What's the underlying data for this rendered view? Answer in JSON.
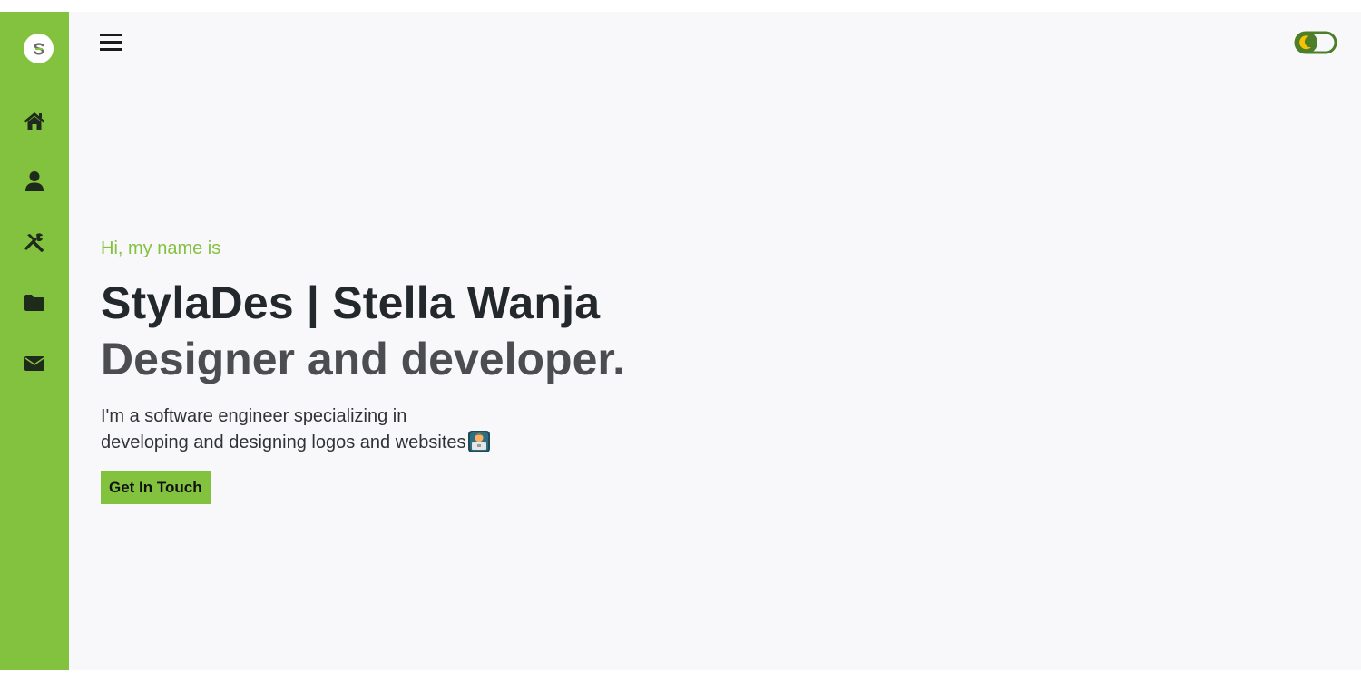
{
  "sidebar": {
    "logo_icon": "styldes-logo-icon",
    "nav_items": [
      {
        "name": "home",
        "icon": "home-icon"
      },
      {
        "name": "about",
        "icon": "user-icon"
      },
      {
        "name": "services",
        "icon": "tools-icon"
      },
      {
        "name": "portfolio",
        "icon": "folder-icon"
      },
      {
        "name": "contact",
        "icon": "envelope-icon"
      }
    ],
    "background_color": "#83c23f"
  },
  "header": {
    "menu_icon": "hamburger-menu-icon",
    "theme_toggle_icon": "dark-mode-toggle-icon"
  },
  "hero": {
    "greeting": "Hi, my name is",
    "name": "StylaDes | Stella Wanja",
    "role": "Designer and developer.",
    "description_line1": "I'm a software engineer specializing in",
    "description_line2": "developing and designing logos and websites",
    "description_emoji": "technologist-emoji",
    "cta_label": "Get In Touch"
  },
  "colors": {
    "accent": "#83c23f",
    "background": "#f8f8fa",
    "heading": "#23282d",
    "subheading": "#4c4d50"
  }
}
